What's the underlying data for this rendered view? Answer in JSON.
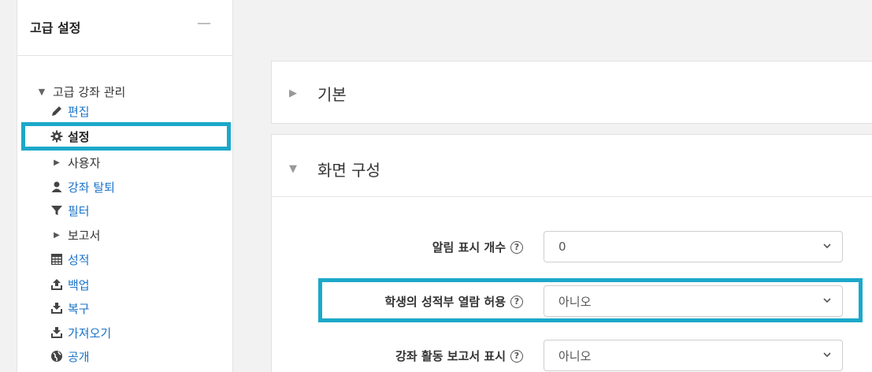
{
  "sidebar": {
    "title": "고급 설정",
    "collapse_symbol": "—",
    "items": [
      {
        "label": "고급 강좌 관리"
      },
      {
        "label": "편집"
      },
      {
        "label": "설정"
      },
      {
        "label": "사용자"
      },
      {
        "label": "강좌 탈퇴"
      },
      {
        "label": "필터"
      },
      {
        "label": "보고서"
      },
      {
        "label": "성적"
      },
      {
        "label": "백업"
      },
      {
        "label": "복구"
      },
      {
        "label": "가져오기"
      },
      {
        "label": "공개"
      }
    ]
  },
  "main": {
    "sections": [
      {
        "title": "기본"
      },
      {
        "title": "화면 구성"
      }
    ],
    "fields": [
      {
        "label": "알림 표시 개수",
        "value": "0"
      },
      {
        "label": "학생의 성적부 열람 허용",
        "value": "아니오"
      },
      {
        "label": "강좌 활동 보고서 표시",
        "value": "아니오"
      }
    ]
  },
  "colors": {
    "accent_highlight": "#1ca8c9",
    "link": "#1a73c8"
  }
}
